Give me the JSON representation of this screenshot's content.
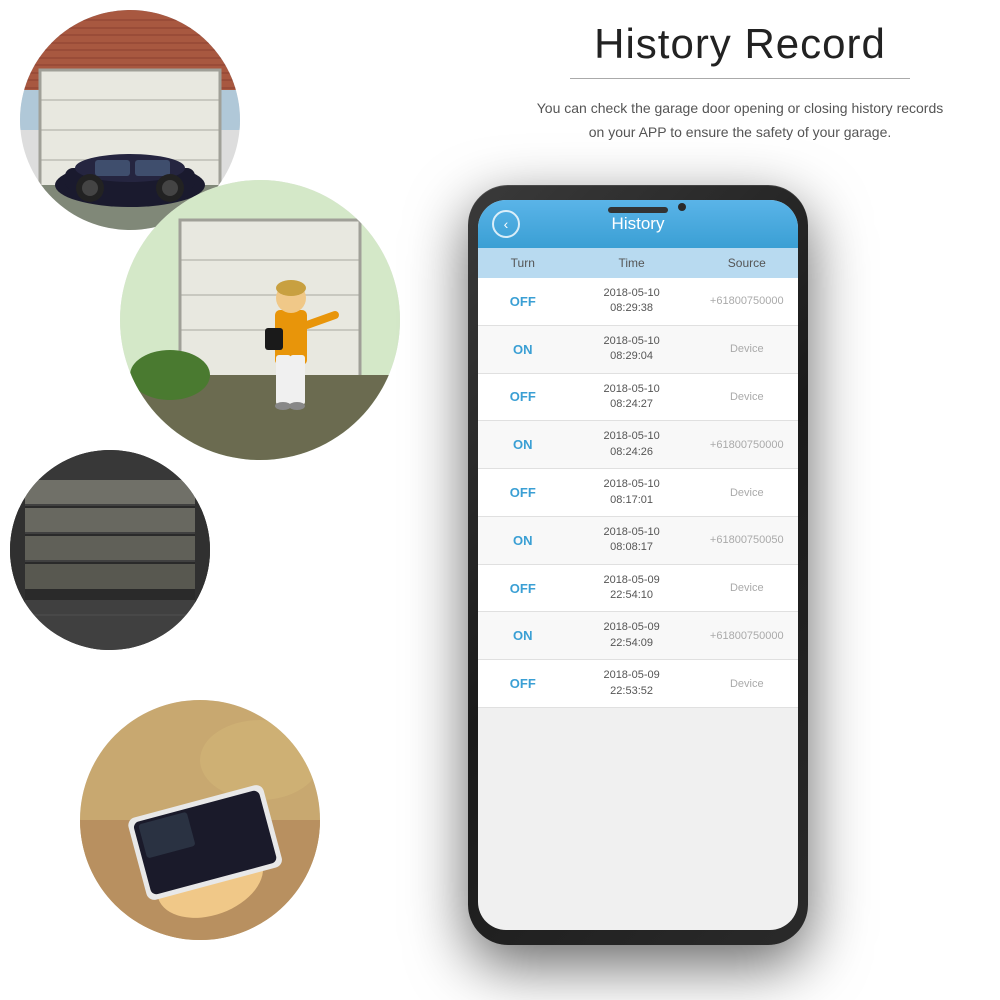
{
  "header": {
    "title": "History Record",
    "divider": true,
    "description_line1": "You can check the garage door opening or closing history records",
    "description_line2": "on your APP to ensure the safety of your garage."
  },
  "app": {
    "header_title": "History",
    "back_icon": "‹",
    "table": {
      "columns": [
        "Turn",
        "Time",
        "Source"
      ],
      "rows": [
        {
          "turn": "OFF",
          "time": "2018-05-10\n08:29:38",
          "source": "+61800750000"
        },
        {
          "turn": "ON",
          "time": "2018-05-10\n08:29:04",
          "source": "Device"
        },
        {
          "turn": "OFF",
          "time": "2018-05-10\n08:24:27",
          "source": "Device"
        },
        {
          "turn": "ON",
          "time": "2018-05-10\n08:24:26",
          "source": "+61800750000"
        },
        {
          "turn": "OFF",
          "time": "2018-05-10\n08:17:01",
          "source": "Device"
        },
        {
          "turn": "ON",
          "time": "2018-05-10\n08:08:17",
          "source": "+61800750050"
        },
        {
          "turn": "OFF",
          "time": "2018-05-09\n22:54:10",
          "source": "Device"
        },
        {
          "turn": "ON",
          "time": "2018-05-09\n22:54:09",
          "source": "+61800750000"
        },
        {
          "turn": "OFF",
          "time": "2018-05-09\n22:53:52",
          "source": "Device"
        }
      ]
    }
  },
  "circles": [
    {
      "id": "circle1",
      "scene": "garage-with-car"
    },
    {
      "id": "circle2",
      "scene": "woman-at-garage"
    },
    {
      "id": "circle3",
      "scene": "opening-garage"
    },
    {
      "id": "circle4",
      "scene": "hand-with-phone"
    }
  ]
}
